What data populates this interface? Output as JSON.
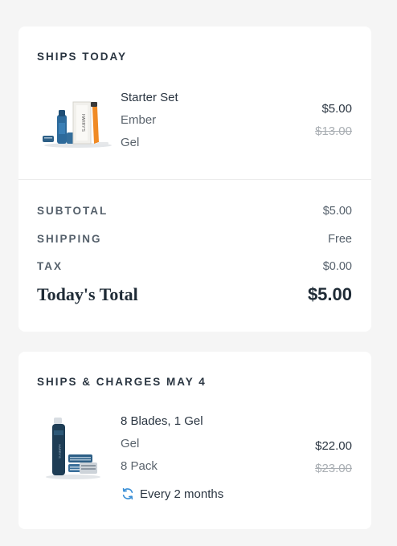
{
  "ships_today": {
    "title": "SHIPS TODAY",
    "item": {
      "name": "Starter Set",
      "options": [
        "Ember",
        "Gel"
      ],
      "price": "$5.00",
      "original_price": "$13.00"
    },
    "summary": {
      "subtotal_label": "SUBTOTAL",
      "subtotal_value": "$5.00",
      "shipping_label": "SHIPPING",
      "shipping_value": "Free",
      "tax_label": "TAX",
      "tax_value": "$0.00",
      "total_label": "Today's Total",
      "total_value": "$5.00"
    }
  },
  "ships_later": {
    "title": "SHIPS & CHARGES MAY 4",
    "item": {
      "name": "8 Blades, 1 Gel",
      "options": [
        "Gel",
        "8 Pack"
      ],
      "price": "$22.00",
      "original_price": "$23.00",
      "frequency": "Every 2 months"
    }
  },
  "colors": {
    "refresh_icon": "#3a8fd6",
    "razor_handle": "#f08a24",
    "product_blue": "#2d5f86",
    "gel_can": "#1e3d55"
  },
  "icons": {
    "recurring": "refresh-icon"
  }
}
